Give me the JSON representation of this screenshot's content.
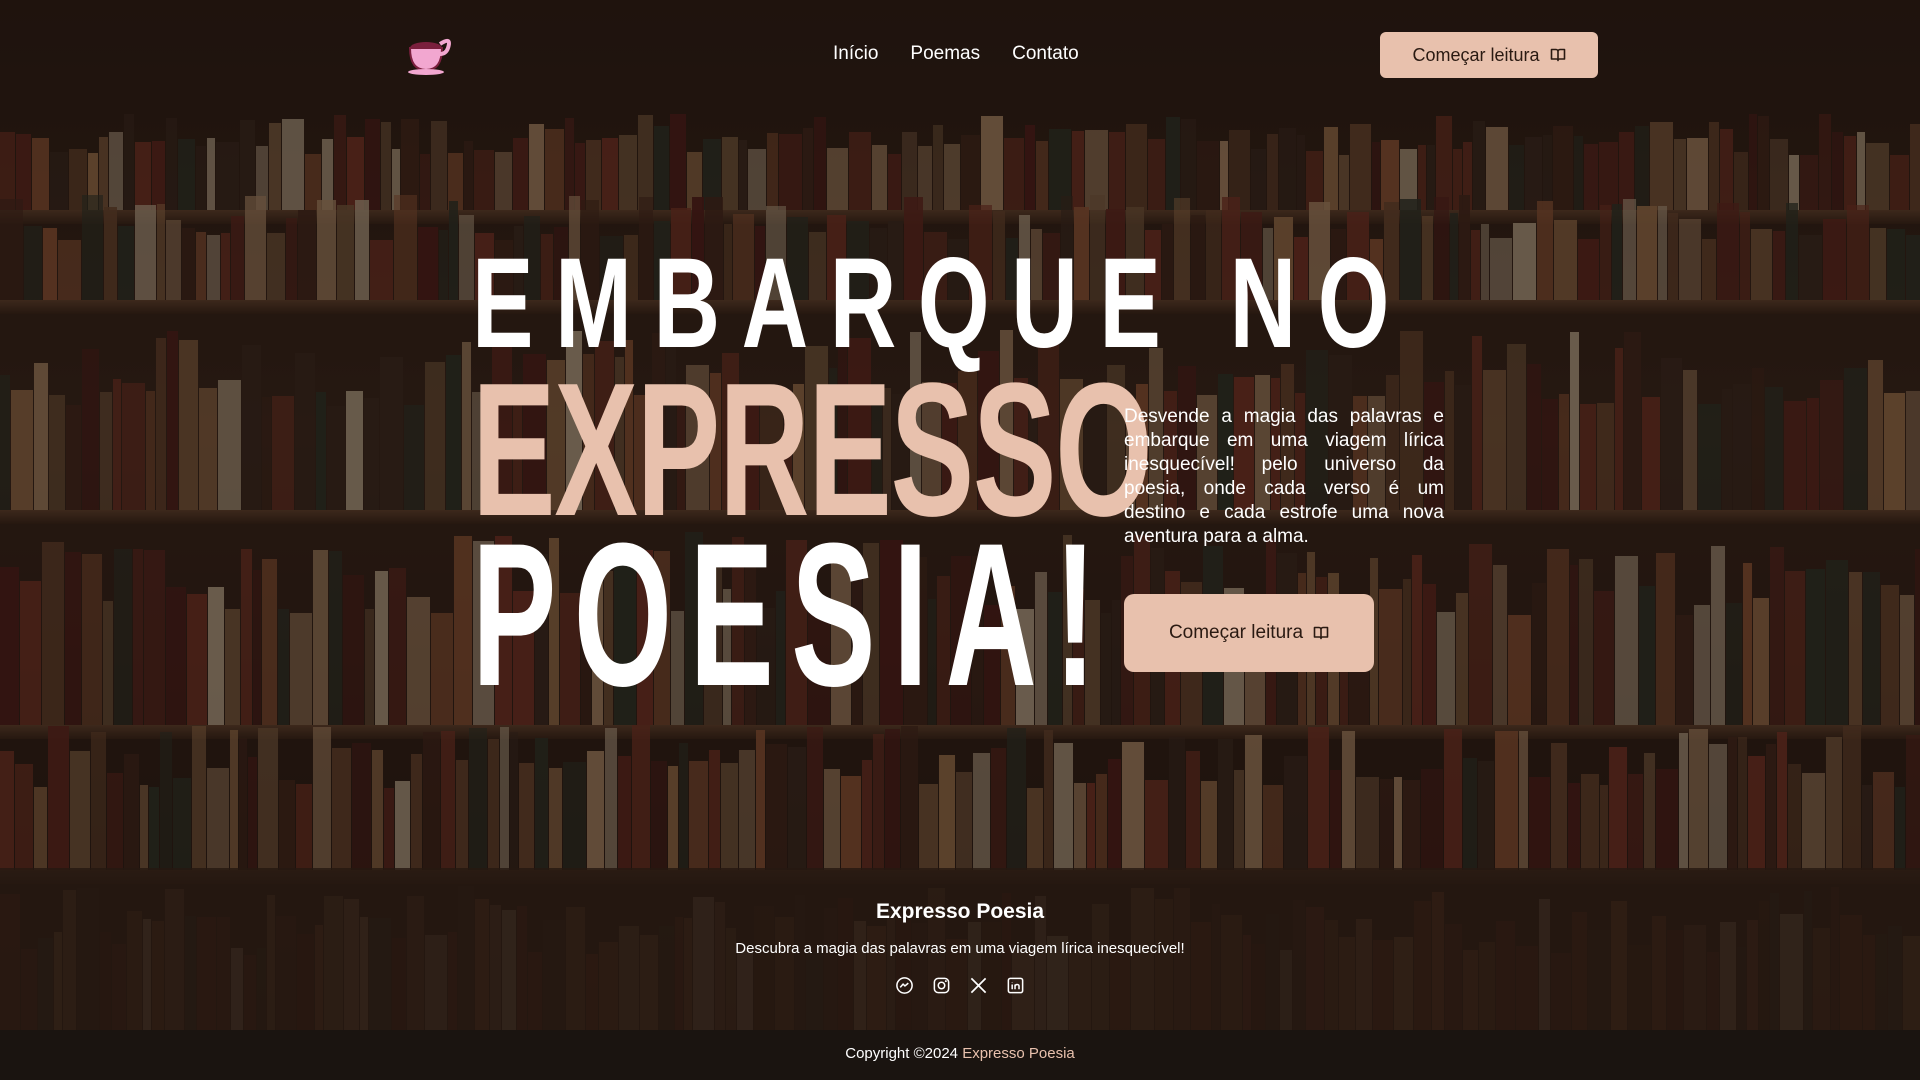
{
  "header": {
    "logo_icon": "coffee-cup-icon",
    "nav": [
      {
        "label": "Início"
      },
      {
        "label": "Poemas"
      },
      {
        "label": "Contato"
      }
    ],
    "cta_label": "Começar leitura",
    "cta_icon": "open-book-icon"
  },
  "hero": {
    "line1": "EMBARQUE NO",
    "line2": "EXPRESSO",
    "line3": "POESIA!",
    "description": "Desvende a magia das palavras e embarque em uma viagem lírica inesquecível! pelo universo da poesia, onde cada verso é um destino e cada estrofe uma nova aventura para a alma.",
    "cta_label": "Começar leitura",
    "cta_icon": "open-book-icon"
  },
  "footer": {
    "title": "Expresso Poesia",
    "subtitle": "Descubra a magia das palavras em uma viagem lírica inesquecível!",
    "socials": [
      "messenger-icon",
      "instagram-icon",
      "x-icon",
      "linkedin-icon"
    ],
    "copyright_prefix": "Copyright ©2024 ",
    "copyright_brand": "Expresso Poesia"
  },
  "colors": {
    "accent": "#e8c1ad",
    "text_dark": "#2a1a12",
    "footer_bg": "#1a1410"
  }
}
